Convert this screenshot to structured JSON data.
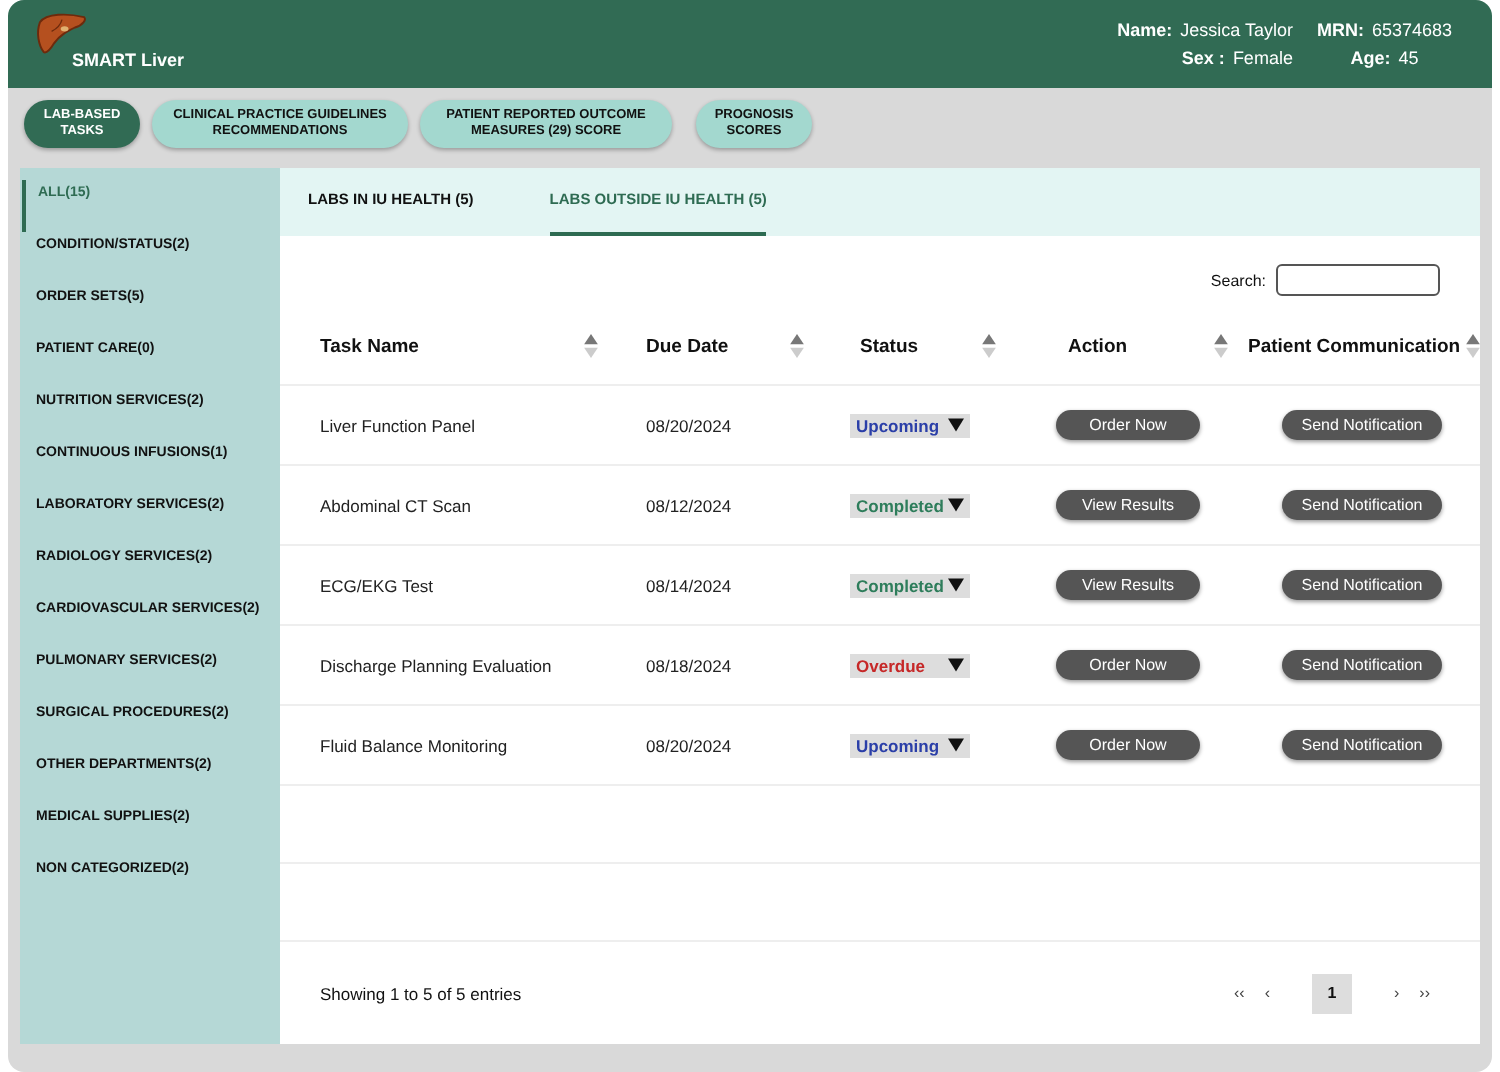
{
  "header": {
    "app_name": "SMART Liver",
    "patient": [
      {
        "label": "Name:",
        "value": "Jessica Taylor"
      },
      {
        "label": "MRN:",
        "value": "65374683"
      },
      {
        "label": "Sex :",
        "value": "Female"
      },
      {
        "label": "Age:",
        "value": "45"
      }
    ]
  },
  "nav": [
    {
      "label": "LAB-BASED TASKS",
      "selected": true
    },
    {
      "label": "CLINICAL PRACTICE GUIDELINES RECOMMENDATIONS",
      "selected": false
    },
    {
      "label": "PATIENT REPORTED OUTCOME MEASURES (29) SCORE",
      "selected": false
    },
    {
      "label": "PROGNOSIS SCORES",
      "selected": false
    }
  ],
  "sidebar": {
    "items": [
      {
        "label": "ALL(15)",
        "selected": true
      },
      {
        "label": "CONDITION/STATUS(2)",
        "selected": false
      },
      {
        "label": "ORDER SETS(5)",
        "selected": false
      },
      {
        "label": "PATIENT CARE(0)",
        "selected": false
      },
      {
        "label": "NUTRITION SERVICES(2)",
        "selected": false
      },
      {
        "label": "CONTINUOUS INFUSIONS(1)",
        "selected": false
      },
      {
        "label": "LABORATORY SERVICES(2)",
        "selected": false
      },
      {
        "label": "RADIOLOGY SERVICES(2)",
        "selected": false
      },
      {
        "label": "CARDIOVASCULAR SERVICES(2)",
        "selected": false
      },
      {
        "label": "PULMONARY SERVICES(2)",
        "selected": false
      },
      {
        "label": "SURGICAL PROCEDURES(2)",
        "selected": false
      },
      {
        "label": "OTHER DEPARTMENTS(2)",
        "selected": false
      },
      {
        "label": "MEDICAL SUPPLIES(2)",
        "selected": false
      },
      {
        "label": "NON CATEGORIZED(2)",
        "selected": false
      }
    ]
  },
  "tabs": [
    {
      "label": "LABS IN IU HEALTH (5)",
      "selected": false
    },
    {
      "label": "LABS OUTSIDE IU HEALTH (5)",
      "selected": true
    }
  ],
  "search": {
    "label": "Search:"
  },
  "table": {
    "columns": [
      "Task Name",
      "Due Date",
      "Status",
      "Action",
      "Patient Communication"
    ],
    "rows": [
      {
        "task": "Liver Function Panel",
        "due": "08/20/2024",
        "status": "Upcoming",
        "color": "#2b3fa8",
        "action": "Order Now",
        "communication": "Send Notification"
      },
      {
        "task": "Abdominal CT Scan",
        "due": "08/12/2024",
        "status": "Completed",
        "color": "#2e7d5b",
        "action": "View Results",
        "communication": "Send Notification"
      },
      {
        "task": "ECG/EKG Test",
        "due": "08/14/2024",
        "status": "Completed",
        "color": "#2e7d5b",
        "action": "View Results",
        "communication": "Send Notification"
      },
      {
        "task": "Discharge Planning Evaluation",
        "due": "08/18/2024",
        "status": "Overdue",
        "color": "#c62828",
        "action": "Order Now",
        "communication": "Send Notification"
      },
      {
        "task": "Fluid Balance Monitoring",
        "due": "08/20/2024",
        "status": "Upcoming",
        "color": "#2b3fa8",
        "action": "Order Now",
        "communication": "Send Notification"
      }
    ]
  },
  "footer": {
    "summary": "Showing 1 to 5 of 5 entries",
    "pagination": [
      {
        "label": "‹‹",
        "selected": false
      },
      {
        "label": "‹",
        "selected": false
      },
      {
        "label": "1",
        "selected": true
      },
      {
        "label": "›",
        "selected": false
      },
      {
        "label": "››",
        "selected": false
      }
    ]
  }
}
